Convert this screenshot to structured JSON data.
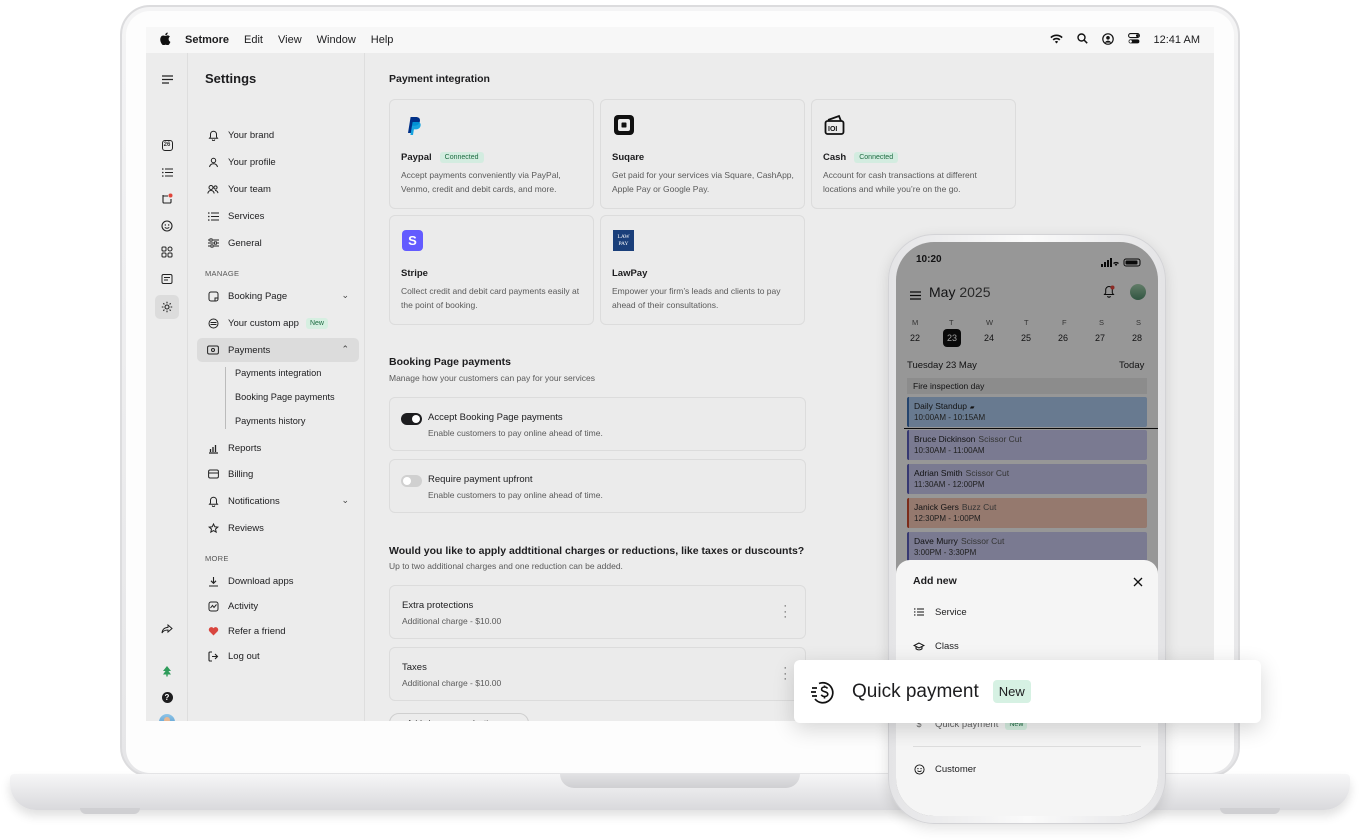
{
  "menubar": {
    "app": "Setmore",
    "items": [
      "Edit",
      "View",
      "Window",
      "Help"
    ],
    "clock": "12:41 AM"
  },
  "sidebar": {
    "title": "Settings",
    "top_items": [
      "Your brand",
      "Your profile",
      "Your team",
      "Services",
      "General"
    ],
    "manage_label": "MANAGE",
    "manage_items": {
      "booking_page": "Booking Page",
      "custom_app": "Your custom app",
      "custom_app_badge": "New",
      "payments": "Payments",
      "payments_sub": [
        "Payments integration",
        "Booking Page payments",
        "Payments history"
      ],
      "reports": "Reports",
      "billing": "Billing",
      "notifications": "Notifications",
      "reviews": "Reviews"
    },
    "more_label": "MORE",
    "more_items": [
      "Download apps",
      "Activity",
      "Refer a friend",
      "Log out"
    ],
    "rail_date": "26"
  },
  "integration": {
    "title": "Payment integration",
    "cards": [
      {
        "name": "Paypal",
        "status": "Connected",
        "desc": "Accept payments conveniently via PayPal, Venmo, credit and debit cards, and more."
      },
      {
        "name": "Suqare",
        "status": "",
        "desc": "Get paid for your services via Square, CashApp, Apple Pay or Google Pay."
      },
      {
        "name": "Cash",
        "status": "Connected",
        "desc": "Account for cash transactions at different locations and while you’re on the go."
      },
      {
        "name": "Stripe",
        "status": "",
        "desc": "Collect credit and debit card payments easily at the point of booking."
      },
      {
        "name": "LawPay",
        "status": "",
        "desc": "Empower your firm’s leads and clients to pay ahead of their consultations."
      }
    ],
    "lawpay_logo": "LAW PAY"
  },
  "booking_payments": {
    "title": "Booking Page payments",
    "desc": "Manage how your customers can pay for your services",
    "options": [
      {
        "title": "Accept Booking Page payments",
        "desc": "Enable customers to pay online ahead of time.",
        "on": true
      },
      {
        "title": "Require payment upfront",
        "desc": "Enable customers to pay online ahead of time.",
        "on": false
      }
    ]
  },
  "charges": {
    "title": "Would you like to apply addtitional charges or reductions, like taxes or duscounts?",
    "desc": "Up to two additional charges and one reduction can be added.",
    "items": [
      {
        "title": "Extra protections",
        "desc": "Additional charge - $10.00"
      },
      {
        "title": "Taxes",
        "desc": "Additional charge - $10.00"
      }
    ],
    "add_button": "+ Add charge or reduction"
  },
  "phone": {
    "time": "10:20",
    "month": "May",
    "year": "2025",
    "weekdays": [
      "M",
      "T",
      "W",
      "T",
      "F",
      "S",
      "S"
    ],
    "dates": [
      "22",
      "23",
      "24",
      "25",
      "26",
      "27",
      "28"
    ],
    "day_label": "Tuesday 23 May",
    "today": "Today",
    "allday": "Fire inspection day",
    "events": [
      {
        "name": "Daily Standup",
        "service": "",
        "time": "10:00AM - 10:15AM",
        "color": "#a9c6e8",
        "border": "#3d6fb0"
      },
      {
        "name": "Bruce Dickinson",
        "service": "Scissor Cut",
        "time": "10:30AM - 11:00AM",
        "color": "#c5c6ea",
        "border": "#5a5cb8"
      },
      {
        "name": "Adrian Smith",
        "service": "Scissor Cut",
        "time": "11:30AM - 12:00PM",
        "color": "#c5c6ea",
        "border": "#5a5cb8"
      },
      {
        "name": "Janick Gers",
        "service": "Buzz Cut",
        "time": "12:30PM - 1:00PM",
        "color": "#f1c3b2",
        "border": "#c9472a"
      },
      {
        "name": "Dave Murry",
        "service": "Scissor Cut",
        "time": "3:00PM - 3:30PM",
        "color": "#c5c6ea",
        "border": "#5a5cb8"
      }
    ],
    "sheet": {
      "title": "Add new",
      "items": [
        "Service",
        "Class",
        "Quick payment",
        "Customer"
      ],
      "badge": "New"
    }
  },
  "popout": {
    "label": "Quick payment",
    "badge": "New"
  },
  "colors": {
    "accent_green": "#d6efe1",
    "toggle_on": "#1d1d1f",
    "paypal": "#003087",
    "stripe": "#635bff",
    "lawpay": "#1a3f7a"
  }
}
